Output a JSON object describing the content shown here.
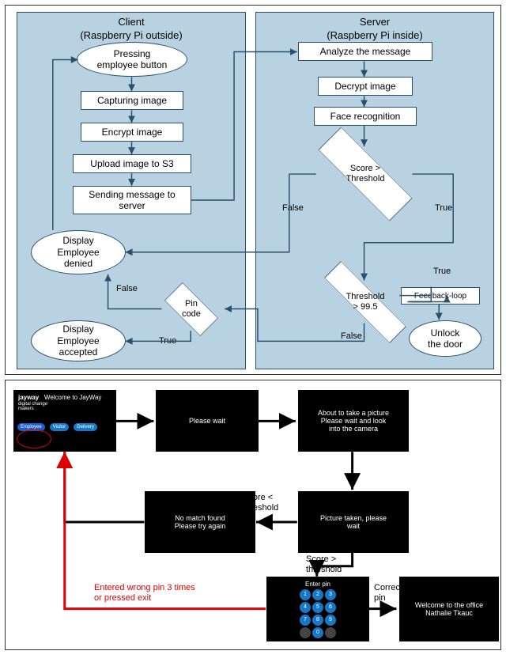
{
  "fig1": {
    "client_title": "Client\n(Raspberry Pi outside)",
    "server_title": "Server\n(Raspberry Pi inside)",
    "press_button": "Pressing\nemployee button",
    "capture": "Capturing image",
    "encrypt_img": "Encrypt image",
    "upload_s3": "Upload image to S3",
    "send_msg": "Sending message to\nserver",
    "analyze": "Analyze the message",
    "decrypt_img": "Decrypt image",
    "face_rec": "Face recognition",
    "score_thr": "Score >\nThreshold",
    "thr_995": "Threshold\n> 99.5",
    "pin_code": "Pin\ncode",
    "feedback": "Feedback-loop",
    "unlock": "Unlock\nthe door",
    "emp_denied": "Display\nEmployee\ndenied",
    "emp_accepted": "Display\nEmployee\naccepted",
    "true": "True",
    "false": "False"
  },
  "fig2": {
    "welcome_header": "Welcome to JayWay",
    "brand": "jayway",
    "tagline": "digital change\nmakers",
    "btn_employee": "Employee",
    "btn_visitor": "Visitor",
    "btn_delivery": "Delivery",
    "please_wait": "Please wait",
    "about_pic": "About to take a picture\nPlease wait and look\ninto the camera",
    "picture_taken": "Picture taken, please\nwait",
    "no_match": "No match found\nPlease try again",
    "enter_pin": "Enter pin",
    "welcome_office": "Welcome to the office\nNathalie Tkauc",
    "score_lt": "Score <\nthreshold",
    "score_gt": "Score >\nthreshold",
    "wrong_pin": "Entered wrong pin 3 times\nor pressed exit",
    "correct_pin": "Correct\npin",
    "keys": [
      "1",
      "2",
      "3",
      "4",
      "5",
      "6",
      "7",
      "8",
      "9",
      "",
      "0",
      ""
    ]
  }
}
